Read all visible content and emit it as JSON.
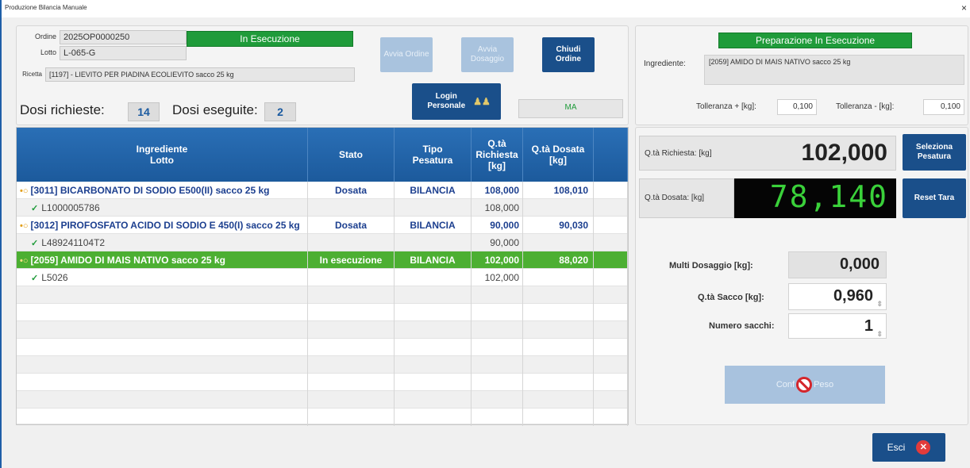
{
  "window": {
    "title": "Produzione Bilancia Manuale",
    "close_glyph": "×"
  },
  "order": {
    "ordine_label": "Ordine",
    "ordine_value": "2025OP0000250",
    "lotto_label": "Lotto",
    "lotto_value": "L-065-G",
    "ricetta_label": "Ricetta",
    "ricetta_value": "[1197] - LIEVITO PER PIADINA ECOLIEVITO sacco 25 kg",
    "status": "In Esecuzione",
    "dosi_richieste_label": "Dosi richieste:",
    "dosi_richieste_value": "14",
    "dosi_eseguite_label": "Dosi eseguite:",
    "dosi_eseguite_value": "2",
    "ma_label": "MA"
  },
  "buttons": {
    "avvia_ordine": "Avvia Ordine",
    "avvia_dosaggio": "Avvia Dosaggio",
    "chiudi_ordine": "Chiudi Ordine",
    "login_personale": "Login Personale",
    "seleziona_pesatura": "Seleziona Pesatura",
    "reset_tara": "Reset Tara",
    "conferma_peso_left": "Conf",
    "conferma_peso_right": "Peso",
    "esci": "Esci"
  },
  "table": {
    "headers": {
      "ingrediente": "Ingrediente",
      "lotto": "Lotto",
      "stato": "Stato",
      "tipo1": "Tipo",
      "tipo2": "Pesatura",
      "rich1": "Q.tà",
      "rich2": "Richiesta",
      "rich3": "[kg]",
      "dos1": "Q.tà Dosata",
      "dos2": "[kg]"
    },
    "rows": [
      {
        "kind": "ingredient",
        "name": "[3011] BICARBONATO DI SODIO E500(II) sacco 25 kg",
        "stato": "Dosata",
        "tipo": "BILANCIA",
        "richiesta": "108,000",
        "dosata": "108,010"
      },
      {
        "kind": "lot",
        "name": "L1000005786",
        "stato": "",
        "tipo": "",
        "richiesta": "108,000",
        "dosata": ""
      },
      {
        "kind": "ingredient",
        "name": "[3012] PIROFOSFATO ACIDO DI SODIO E 450(I) sacco 25 kg",
        "stato": "Dosata",
        "tipo": "BILANCIA",
        "richiesta": "90,000",
        "dosata": "90,030"
      },
      {
        "kind": "lot",
        "name": "L489241104T2",
        "stato": "",
        "tipo": "",
        "richiesta": "90,000",
        "dosata": ""
      },
      {
        "kind": "active",
        "name": "[2059] AMIDO DI MAIS NATIVO sacco 25 kg",
        "stato": "In esecuzione",
        "tipo": "BILANCIA",
        "richiesta": "102,000",
        "dosata": "88,020"
      },
      {
        "kind": "lot",
        "name": "L5026",
        "stato": "",
        "tipo": "",
        "richiesta": "102,000",
        "dosata": ""
      }
    ]
  },
  "preparation": {
    "status": "Preparazione In Esecuzione",
    "ingrediente_label": "Ingrediente:",
    "ingrediente_value": "[2059] AMIDO DI MAIS NATIVO sacco 25 kg",
    "tol_plus_label": "Tolleranza + [kg]:",
    "tol_plus_value": "0,100",
    "tol_minus_label": "Tolleranza - [kg]:",
    "tol_minus_value": "0,100"
  },
  "weighing": {
    "richiesta_label": "Q.tà Richiesta: [kg]",
    "richiesta_value": "102,000",
    "dosata_label": "Q.tà Dosata: [kg]",
    "dosata_value": "78,140",
    "multi_label": "Multi Dosaggio [kg]:",
    "multi_value": "0,000",
    "sacco_label": "Q.tà Sacco [kg]:",
    "sacco_value": "0,960",
    "sacchi_label": "Numero sacchi:",
    "sacchi_value": "1"
  },
  "colors": {
    "accent_blue": "#1a4f8a",
    "status_green": "#1f9b3a",
    "active_row": "#4caf32",
    "lcd_green": "#3ad13a"
  }
}
